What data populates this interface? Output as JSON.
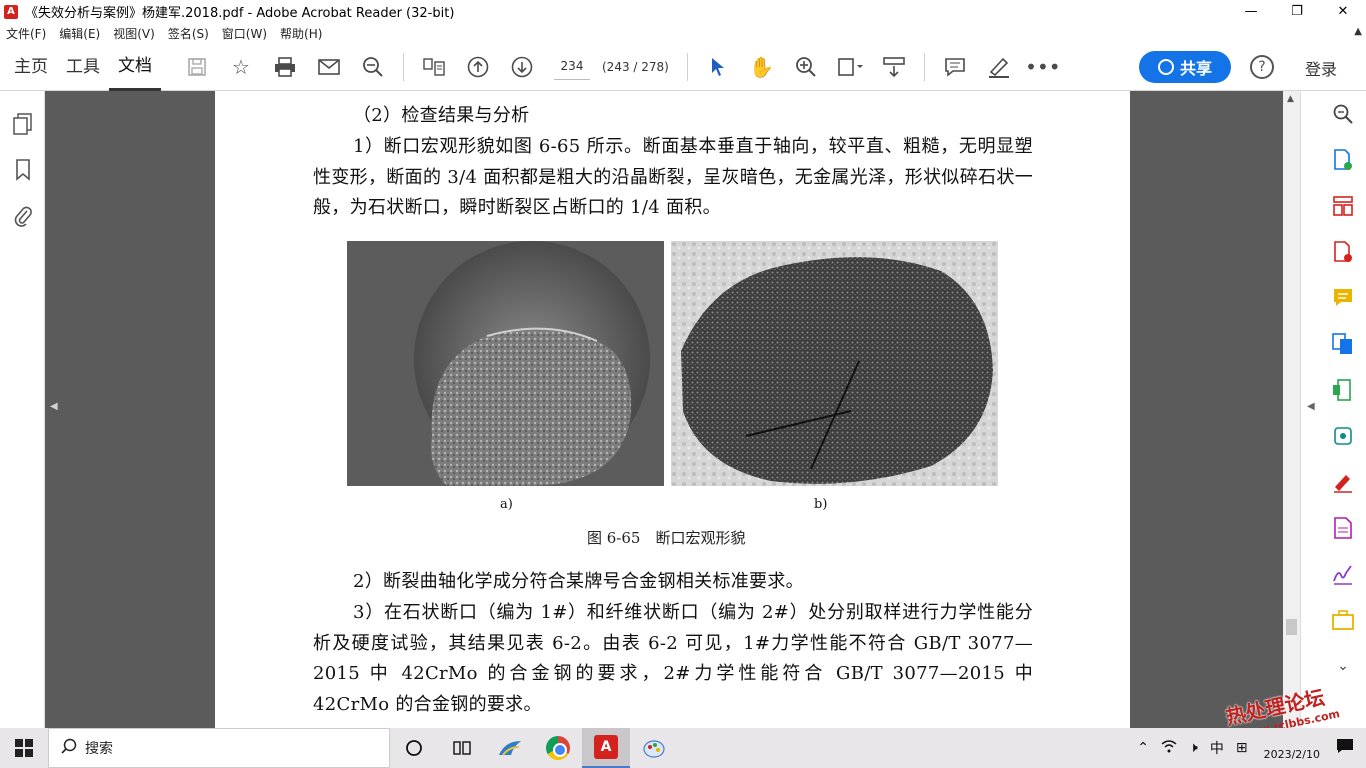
{
  "window": {
    "title": "《失效分析与案例》杨建军.2018.pdf - Adobe Acrobat Reader (32-bit)",
    "minimize": "—",
    "maximize": "❐",
    "close": "✕"
  },
  "menu": {
    "items": [
      "文件(F)",
      "编辑(E)",
      "视图(V)",
      "签名(S)",
      "窗口(W)",
      "帮助(H)"
    ]
  },
  "toolbar": {
    "tabs": [
      "主页",
      "工具",
      "文档"
    ],
    "active_tab": "文档",
    "page_input": "234",
    "page_count": "(243 / 278)",
    "share_label": "共享",
    "login_label": "登录",
    "help_label": "?"
  },
  "document": {
    "heading": "（2）检查结果与分析",
    "para1": "1）断口宏观形貌如图 6-65 所示。断面基本垂直于轴向，较平直、粗糙，无明显塑性变形，断面的 3/4 面积都是粗大的沿晶断裂，呈灰暗色，无金属光泽，形状似碎石状一般，为石状断口，瞬时断裂区占断口的 1/4 面积。",
    "figure_label_a": "a)",
    "figure_label_b": "b)",
    "figure_caption": "图 6-65　断口宏观形貌",
    "para2": "2）断裂曲轴化学成分符合某牌号合金钢相关标准要求。",
    "para3": "3）在石状断口（编为 1#）和纤维状断口（编为 2#）处分别取样进行力学性能分析及硬度试验，其结果见表 6-2。由表 6-2 可见，1#力学性能不符合 GB/T 3077—2015 中 42CrMo 的合金钢的要求，2#力学性能符合 GB/T 3077—2015 中 42CrMo 的合金钢的要求。"
  },
  "taskbar": {
    "search_label": "搜索",
    "ime": "中",
    "date": "2023/2/10"
  },
  "watermark": {
    "main": "热处理论坛",
    "sub": "www.rclbbs.com"
  },
  "colors": {
    "accent": "#1473e6",
    "acrobat_red": "#d4231f",
    "doc_background": "#5b5b5b"
  }
}
